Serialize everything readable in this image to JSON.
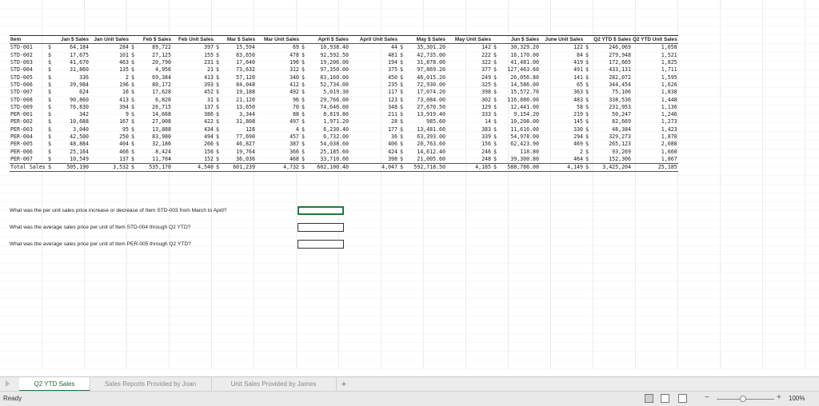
{
  "headers": [
    "Item",
    "Jan $ Sales",
    "Jan Unit Sales",
    "Feb $ Sales",
    "Feb Unit Sales",
    "Mar $ Sales",
    "Mar Unit Sales",
    "April $ Sales",
    "April Unit Sales",
    "May $ Sales",
    "May Unit Sales",
    "Jun $ Sales",
    "June Unit Sales",
    "Q2 YTD $ Sales",
    "Q2 YTD Unit Sales"
  ],
  "currency_symbol": "$",
  "rows": [
    [
      "STD-001",
      "64,184",
      "284",
      "89,722",
      "397",
      "15,594",
      "69",
      "10,938.40",
      "44",
      "35,301.20",
      "142",
      "30,329.20",
      "122",
      "246,069",
      "1,058"
    ],
    [
      "STD-002",
      "17,675",
      "101",
      "27,125",
      "155",
      "83,650",
      "478",
      "92,592.50",
      "481",
      "42,735.00",
      "222",
      "16,170.00",
      "84",
      "279,948",
      "1,521"
    ],
    [
      "STD-003",
      "41,670",
      "463",
      "20,790",
      "231",
      "17,640",
      "196",
      "19,206.00",
      "194",
      "31,878.00",
      "322",
      "41,481.00",
      "419",
      "172,665",
      "1,825"
    ],
    [
      "STD-004",
      "31,860",
      "135",
      "4,956",
      "21",
      "73,632",
      "312",
      "97,350.00",
      "375",
      "97,869.20",
      "377",
      "127,463.60",
      "491",
      "433,131",
      "1,711"
    ],
    [
      "STD-005",
      "336",
      "2",
      "69,384",
      "413",
      "57,120",
      "340",
      "83,160.00",
      "450",
      "46,015.20",
      "249",
      "26,056.80",
      "141",
      "282,072",
      "1,595"
    ],
    [
      "STD-006",
      "39,984",
      "196",
      "80,172",
      "393",
      "84,048",
      "412",
      "52,734.00",
      "235",
      "72,930.00",
      "325",
      "14,586.00",
      "65",
      "344,454",
      "1,626"
    ],
    [
      "STD-007",
      "624",
      "16",
      "17,628",
      "452",
      "19,188",
      "492",
      "5,019.30",
      "117",
      "17,074.20",
      "398",
      "15,572.70",
      "363",
      "75,106",
      "1,838"
    ],
    [
      "STD-008",
      "90,860",
      "413",
      "6,820",
      "31",
      "21,120",
      "96",
      "29,766.00",
      "123",
      "73,084.00",
      "302",
      "116,886.00",
      "483",
      "338,536",
      "1,448"
    ],
    [
      "STD-009",
      "76,830",
      "394",
      "26,715",
      "137",
      "13,650",
      "70",
      "74,646.00",
      "348",
      "27,670.50",
      "129",
      "12,441.00",
      "58",
      "231,953",
      "1,136"
    ],
    [
      "PER-001",
      "342",
      "9",
      "14,668",
      "386",
      "3,344",
      "88",
      "8,819.80",
      "211",
      "13,919.40",
      "333",
      "9,154.20",
      "219",
      "50,247",
      "1,246"
    ],
    [
      "PER-002",
      "10,688",
      "167",
      "27,008",
      "422",
      "31,808",
      "497",
      "1,971.20",
      "28",
      "985.60",
      "14",
      "10,208.00",
      "145",
      "82,669",
      "1,273"
    ],
    [
      "PER-003",
      "3,040",
      "95",
      "13,888",
      "434",
      "128",
      "4",
      "6,230.40",
      "177",
      "13,481.60",
      "383",
      "11,616.00",
      "330",
      "48,384",
      "1,423"
    ],
    [
      "PER-004",
      "42,500",
      "250",
      "83,980",
      "494",
      "77,690",
      "457",
      "6,732.00",
      "36",
      "63,393.00",
      "339",
      "54,978.00",
      "294",
      "329,273",
      "1,870"
    ],
    [
      "PER-005",
      "48,884",
      "404",
      "32,186",
      "266",
      "46,827",
      "387",
      "54,038.60",
      "406",
      "20,763.60",
      "156",
      "62,423.90",
      "469",
      "265,123",
      "2,088"
    ],
    [
      "PER-006",
      "25,164",
      "466",
      "8,424",
      "156",
      "19,764",
      "366",
      "25,185.60",
      "424",
      "14,612.40",
      "246",
      "118.80",
      "2",
      "93,269",
      "1,660"
    ],
    [
      "PER-007",
      "10,549",
      "137",
      "11,704",
      "152",
      "36,036",
      "468",
      "33,710.60",
      "398",
      "21,005.60",
      "248",
      "39,300.80",
      "464",
      "152,306",
      "1,867"
    ]
  ],
  "total": [
    "Total Sales",
    "505,190",
    "3,532",
    "535,170",
    "4,540",
    "601,239",
    "4,732",
    "602,100.40",
    "4,047",
    "592,718.50",
    "4,185",
    "588,786.00",
    "4,149",
    "3,425,204",
    "25,185"
  ],
  "questions": [
    "What was the per unit sales price increase or decrease of Item STD-003 from March to April?",
    "What was the average sales price per unit of Item STD-004 through Q2 YTD?",
    "What was the average sales price per unit of Item PER-005 through Q2 YTD?"
  ],
  "sheet_tabs": [
    "Q2 YTD Sales",
    "Sales Reports Provided by Joan",
    "Unit Sales Provided by James"
  ],
  "add_sheet_label": "+",
  "status": {
    "ready": "Ready",
    "zoom": "100%",
    "zoom_minus": "−",
    "zoom_plus": "+"
  }
}
